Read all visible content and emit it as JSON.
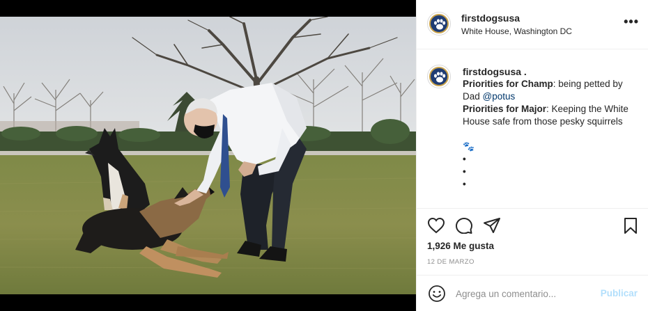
{
  "post": {
    "username": "firstdogsusa",
    "location": "White House, Washington DC",
    "caption": {
      "username": "firstdogsusa .",
      "champ_label": "Priorities for Champ",
      "champ_text": ": being petted by Dad ",
      "mention": "@potus",
      "major_label": "Priorities for Major",
      "major_text": ": Keeping the White House safe from those pesky squirrels",
      "paw": "🐾",
      "dots": [
        "•",
        "•",
        "•"
      ]
    },
    "likes": "1,926 Me gusta",
    "date": "12 DE MARZO",
    "comment_placeholder": "Agrega un comentario...",
    "publish_label": "Publicar"
  },
  "icons": {
    "more": "more-options-icon",
    "like": "heart-icon",
    "comment": "comment-bubble-icon",
    "share": "paper-plane-icon",
    "save": "bookmark-icon",
    "emoji": "smiley-icon",
    "avatar": "paw-print-icon"
  },
  "colors": {
    "avatar_bg": "#1f3c73",
    "avatar_ring": "#c9a24a",
    "link": "#00376b",
    "publish_disabled": "#b2dffc"
  }
}
